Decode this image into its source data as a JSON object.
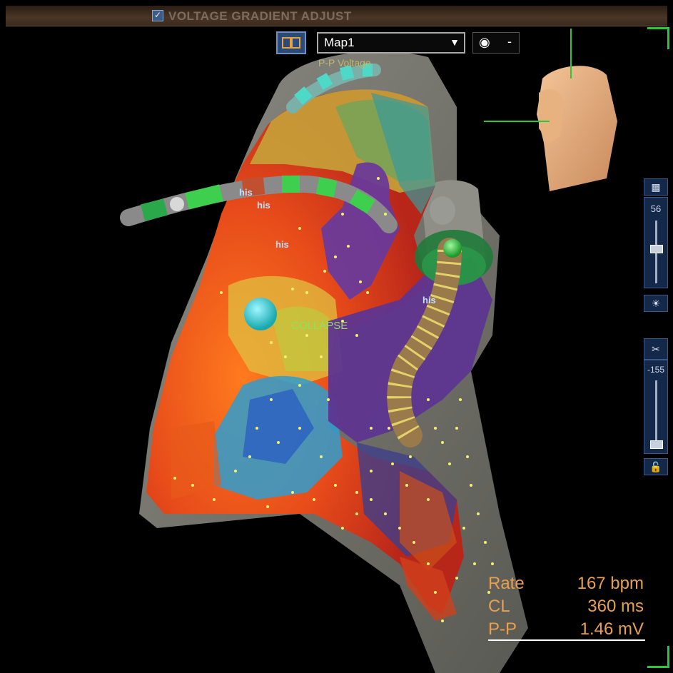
{
  "window": {
    "title": "VOLTAGE GRADIENT ADJUST",
    "title_checkbox_checked": true
  },
  "map_toolbar": {
    "layout_button_icon": "split-view-icon",
    "map_select_value": "Map1",
    "visibility_icon": "eye-icon",
    "visibility_state": "-",
    "map_type_label": "P-P Voltage"
  },
  "controls": {
    "slider1_value": "56",
    "slider2_value": "-155",
    "icons": [
      "layer-toggle-icon",
      "light-icon",
      "clip-icon",
      "lock-icon"
    ]
  },
  "catheter_labels": {
    "label_a": "his",
    "label_b": "his",
    "label_c": "his",
    "label_d": "his",
    "collapse": "COLLAPSE"
  },
  "readout": {
    "rate_label": "Rate",
    "rate_value": "167 bpm",
    "cl_label": "CL",
    "cl_value": "360 ms",
    "pp_label": "P-P",
    "pp_value": "1.46 mV"
  },
  "colors": {
    "accent_text": "#e8a050",
    "frame_green": "#29c83a",
    "panel_blue": "#14284a"
  }
}
